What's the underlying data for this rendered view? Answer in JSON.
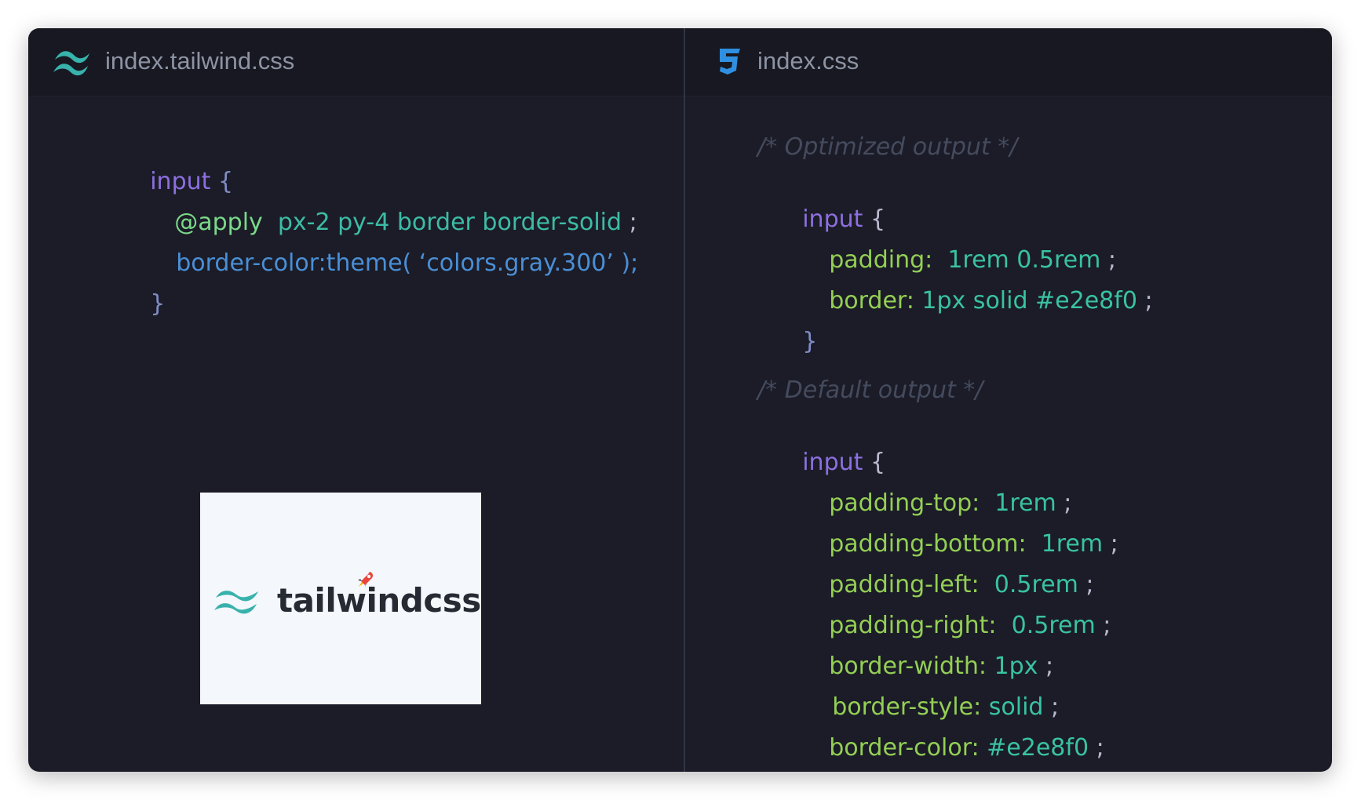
{
  "left_tab": {
    "icon": "tailwind-icon",
    "label": "index.tailwind.css"
  },
  "right_tab": {
    "icon": "css3-icon",
    "label": "index.css"
  },
  "left_code": {
    "line1": {
      "selector": "input",
      "brace": "{"
    },
    "line2": {
      "at_rule": "@apply",
      "classes": "px-2 py-4 border border-solid",
      "semicolon": ";"
    },
    "line3": {
      "text": "border-color:theme( ‘colors.gray.300’ );"
    },
    "line4": {
      "brace": "}"
    }
  },
  "right_code": {
    "comment1": "/* Optimized output */",
    "block1_selector": "input",
    "block1_open": "{",
    "block1_decls": [
      {
        "prop": "padding:",
        "value": "1rem 0.5rem",
        "semi": ";"
      },
      {
        "prop": "border:",
        "value": "1px solid #e2e8f0",
        "semi": ";"
      }
    ],
    "block1_close": "}",
    "comment2": "/* Default output */",
    "block2_selector": "input",
    "block2_open": "{",
    "block2_decls": [
      {
        "prop": "padding-top:",
        "value": "1rem",
        "semi": ";"
      },
      {
        "prop": "padding-bottom:",
        "value": "1rem",
        "semi": ";"
      },
      {
        "prop": "padding-left:",
        "value": "0.5rem",
        "semi": ";"
      },
      {
        "prop": "padding-right:",
        "value": "0.5rem",
        "semi": ";"
      },
      {
        "prop": "border-width:",
        "value": "1px",
        "semi": ";"
      },
      {
        "prop": "border-style:",
        "value": "solid",
        "semi": ";"
      },
      {
        "prop": "border-color:",
        "value": "#e2e8f0",
        "semi": ";"
      }
    ],
    "block2_close": "}"
  },
  "logo": {
    "text": "tailwindcss",
    "icon": "tailwind-logo-icon",
    "badge_icon": "rocket-icon"
  },
  "colors": {
    "background": "#1b1c27",
    "tabbar": "#171821",
    "tailwind_teal": "#38b2ac",
    "css_blue": "#2f8fe0"
  }
}
